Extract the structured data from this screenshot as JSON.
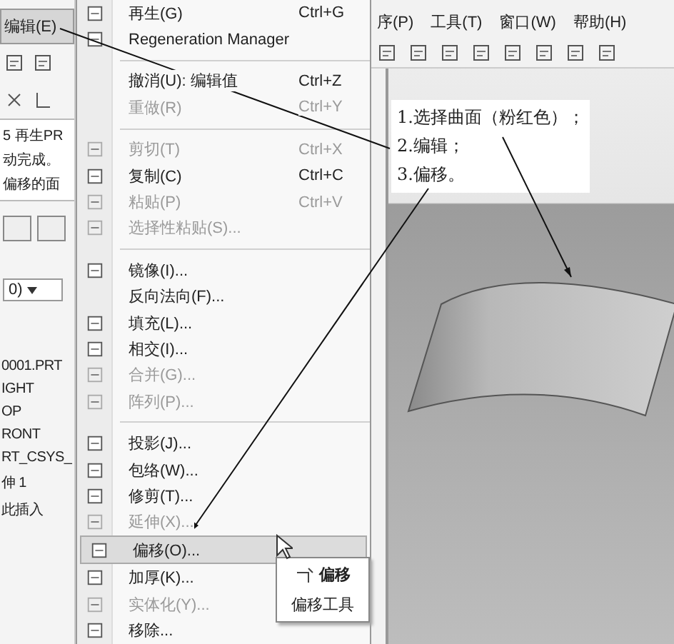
{
  "left_panel": {
    "menu_title": {
      "label": "编辑(E)",
      "selected": true
    },
    "messages": [
      "5 再生PR",
      "动完成。",
      "偏移的面"
    ],
    "dropdown": {
      "value": "0)"
    },
    "tree": [
      "0001.PRT",
      "IGHT",
      "OP",
      "RONT",
      "RT_CSYS_",
      "伸 1",
      "此插入"
    ]
  },
  "edit_menu": {
    "items": [
      {
        "kind": "item",
        "label": "再生(G)",
        "shortcut": "Ctrl+G",
        "disabled": false,
        "icon": true,
        "selected": false
      },
      {
        "kind": "item",
        "label": "Regeneration Manager",
        "disabled": false,
        "icon": true,
        "selected": false
      },
      {
        "kind": "separator"
      },
      {
        "kind": "item",
        "label": "撤消(U): 编辑值",
        "shortcut": "Ctrl+Z",
        "disabled": false,
        "icon": false,
        "selected": false
      },
      {
        "kind": "item",
        "label": "重做(R)",
        "shortcut": "Ctrl+Y",
        "disabled": true,
        "icon": false,
        "selected": false
      },
      {
        "kind": "separator"
      },
      {
        "kind": "item",
        "label": "剪切(T)",
        "shortcut": "Ctrl+X",
        "disabled": true,
        "icon": true,
        "selected": false
      },
      {
        "kind": "item",
        "label": "复制(C)",
        "shortcut": "Ctrl+C",
        "disabled": false,
        "icon": true,
        "selected": false
      },
      {
        "kind": "item",
        "label": "粘贴(P)",
        "shortcut": "Ctrl+V",
        "disabled": true,
        "icon": true,
        "selected": false
      },
      {
        "kind": "item",
        "label": "选择性粘贴(S)...",
        "disabled": true,
        "icon": true,
        "selected": false
      },
      {
        "kind": "separator"
      },
      {
        "kind": "item",
        "label": "镜像(I)...",
        "disabled": false,
        "icon": true,
        "selected": false
      },
      {
        "kind": "item",
        "label": "反向法向(F)...",
        "disabled": false,
        "icon": false,
        "selected": false
      },
      {
        "kind": "item",
        "label": "填充(L)...",
        "disabled": false,
        "icon": true,
        "selected": false
      },
      {
        "kind": "item",
        "label": "相交(I)...",
        "disabled": false,
        "icon": true,
        "selected": false
      },
      {
        "kind": "item",
        "label": "合并(G)...",
        "disabled": true,
        "icon": true,
        "selected": false
      },
      {
        "kind": "item",
        "label": "阵列(P)...",
        "disabled": true,
        "icon": true,
        "selected": false
      },
      {
        "kind": "separator"
      },
      {
        "kind": "item",
        "label": "投影(J)...",
        "disabled": false,
        "icon": true,
        "selected": false
      },
      {
        "kind": "item",
        "label": "包络(W)...",
        "disabled": false,
        "icon": true,
        "selected": false
      },
      {
        "kind": "item",
        "label": "修剪(T)...",
        "disabled": false,
        "icon": true,
        "selected": false
      },
      {
        "kind": "item",
        "label": "延伸(X)...",
        "disabled": true,
        "icon": true,
        "selected": false
      },
      {
        "kind": "item",
        "label": "偏移(O)...",
        "disabled": false,
        "icon": true,
        "selected": true
      },
      {
        "kind": "item",
        "label": "加厚(K)...",
        "disabled": false,
        "icon": true,
        "selected": false
      },
      {
        "kind": "item",
        "label": "实体化(Y)...",
        "disabled": true,
        "icon": true,
        "selected": false
      },
      {
        "kind": "item",
        "label": "移除...",
        "disabled": false,
        "icon": true,
        "selected": false
      }
    ]
  },
  "submenu": {
    "items": [
      {
        "kind": "tool",
        "label": "偏移"
      },
      {
        "kind": "text",
        "label": "偏移工具"
      }
    ]
  },
  "menubar": [
    "序(P)",
    "工具(T)",
    "窗口(W)",
    "帮助(H)"
  ],
  "annotation": [
    "1.选择曲面（粉红色）；",
    "2.编辑；",
    "3.偏移。"
  ]
}
